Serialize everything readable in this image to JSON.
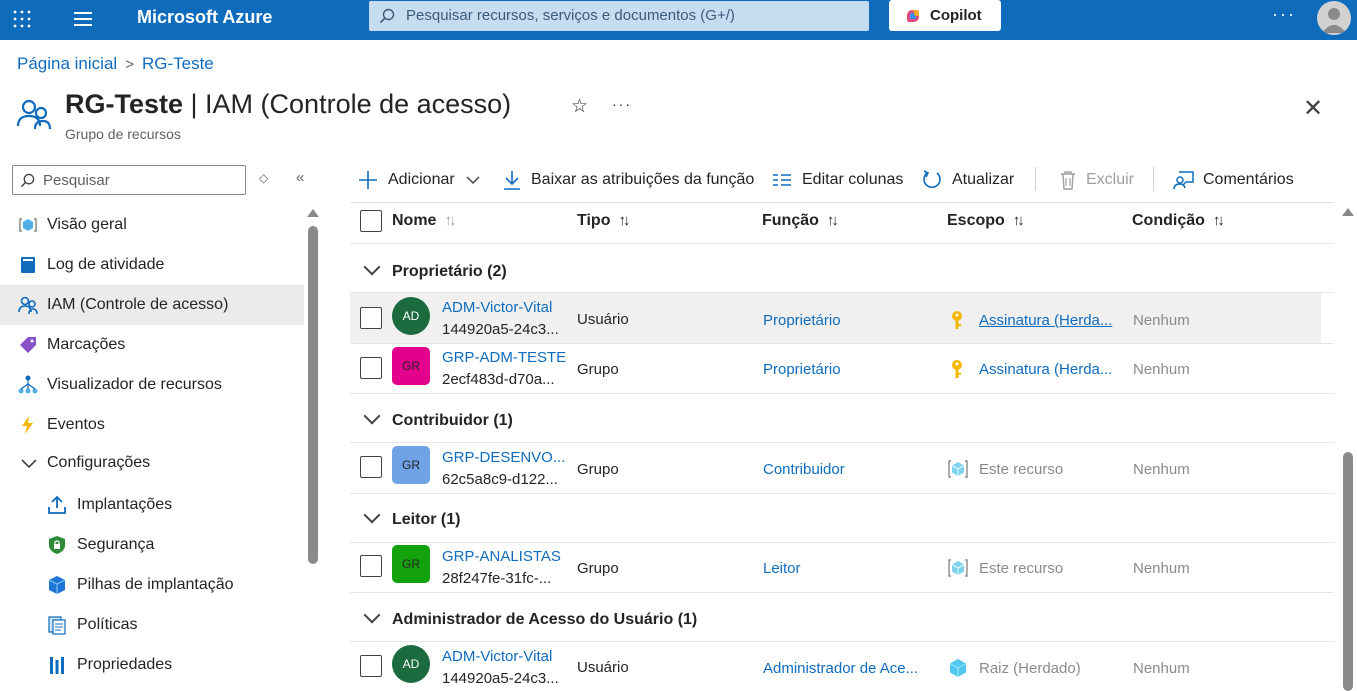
{
  "topbar": {
    "brand": "Microsoft Azure",
    "search_placeholder": "Pesquisar recursos, serviços e documentos (G+/)",
    "copilot_label": "Copilot",
    "more": "···"
  },
  "breadcrumb": {
    "home": "Página inicial",
    "current": "RG-Teste",
    "sep": ">"
  },
  "page": {
    "title_bold": "RG-Teste",
    "title_rest": " | IAM (Controle de acesso)",
    "subtitle": "Grupo de recursos",
    "star": "☆",
    "more": "···",
    "close": "✕"
  },
  "sidebar": {
    "search_placeholder": "Pesquisar",
    "sort_glyph": "◇",
    "collapse_glyph": "«",
    "items": [
      {
        "label": "Visão geral",
        "icon": "overview-icon"
      },
      {
        "label": "Log de atividade",
        "icon": "activity-log-icon"
      },
      {
        "label": "IAM (Controle de acesso)",
        "icon": "iam-icon",
        "active": true
      },
      {
        "label": "Marcações",
        "icon": "tag-icon"
      },
      {
        "label": "Visualizador de recursos",
        "icon": "resource-visualizer-icon"
      },
      {
        "label": "Eventos",
        "icon": "events-icon"
      },
      {
        "label": "Configurações",
        "icon": "chevron-down-icon",
        "expanded": true
      },
      {
        "label": "Implantações",
        "icon": "deployments-icon"
      },
      {
        "label": "Segurança",
        "icon": "security-icon"
      },
      {
        "label": "Pilhas de implantação",
        "icon": "deployment-stacks-icon"
      },
      {
        "label": "Políticas",
        "icon": "policies-icon"
      },
      {
        "label": "Propriedades",
        "icon": "properties-icon"
      }
    ]
  },
  "toolbar": {
    "add": "Adicionar",
    "download": "Baixar as atribuições da função",
    "edit_columns": "Editar colunas",
    "refresh": "Atualizar",
    "delete": "Excluir",
    "feedback": "Comentários"
  },
  "table": {
    "columns": {
      "name": "Nome",
      "type": "Tipo",
      "role": "Função",
      "scope": "Escopo",
      "condition": "Condição"
    },
    "sort_glyph": "↑↓",
    "groups": [
      {
        "label": "Proprietário (2)"
      },
      {
        "label": "Contribuidor (1)"
      },
      {
        "label": "Leitor (1)"
      },
      {
        "label": "Administrador de Acesso do Usuário (1)"
      }
    ],
    "rows": [
      {
        "initials": "AD",
        "name": "ADM-Victor-Vital",
        "id": "144920a5-24c3...",
        "type": "Usuário",
        "role": "Proprietário",
        "scope": "Assinatura (Herda...",
        "condition": "Nenhum"
      },
      {
        "initials": "GR",
        "name": "GRP-ADM-TESTE",
        "id": "2ecf483d-d70a...",
        "type": "Grupo",
        "role": "Proprietário",
        "scope": "Assinatura (Herda...",
        "condition": "Nenhum",
        "avatar_color": "#e3008c"
      },
      {
        "initials": "GR",
        "name": "GRP-DESENVO...",
        "id": "62c5a8c9-d122...",
        "type": "Grupo",
        "role": "Contribuidor",
        "scope": "Este recurso",
        "condition": "Nenhum",
        "avatar_color": "#6fa3e6"
      },
      {
        "initials": "GR",
        "name": "GRP-ANALISTAS",
        "id": "28f247fe-31fc-...",
        "type": "Grupo",
        "role": "Leitor",
        "scope": "Este recurso",
        "condition": "Nenhum",
        "avatar_color": "#13a10e"
      },
      {
        "initials": "AD",
        "name": "ADM-Victor-Vital",
        "id": "144920a5-24c3...",
        "type": "Usuário",
        "role": "Administrador de Ace...",
        "scope": "Raiz (Herdado)",
        "condition": "Nenhum"
      }
    ]
  }
}
